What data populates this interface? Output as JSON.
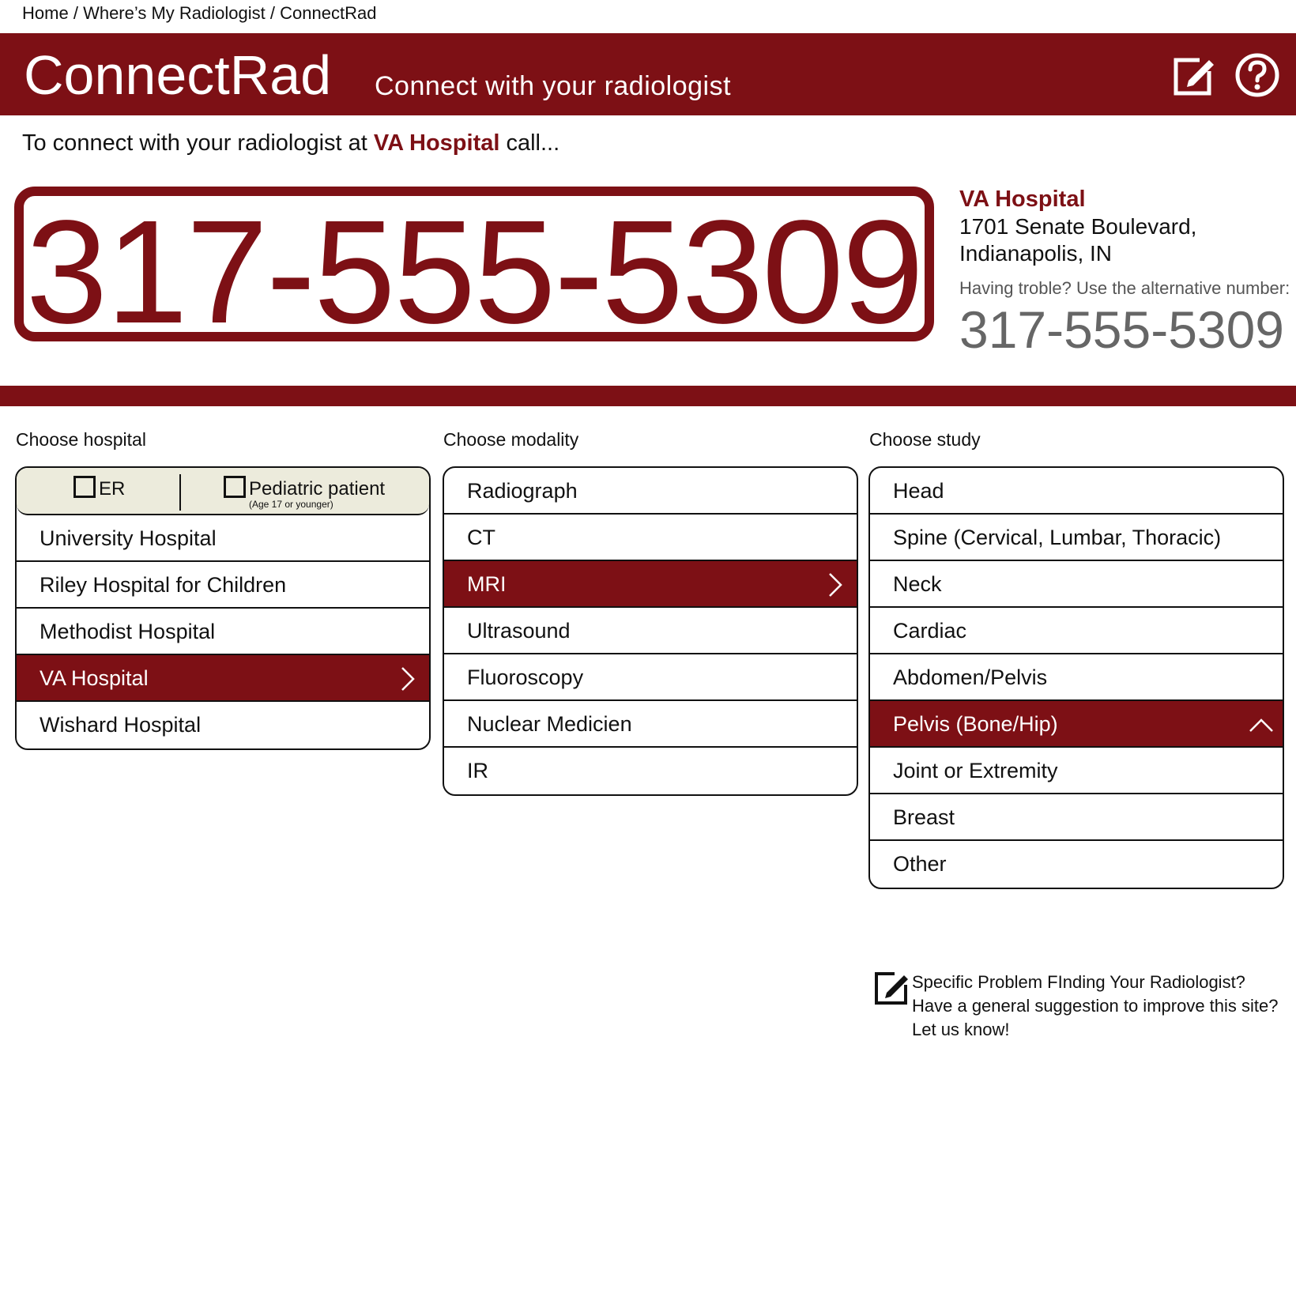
{
  "breadcrumb": {
    "home": "Home",
    "sep1": "/",
    "parent": "Where’s My Radiologist",
    "sep2": "/",
    "current": "ConnectRad"
  },
  "header": {
    "title": "ConnectRad",
    "tagline": "Connect with your radiologist",
    "edit_icon": "edit-icon",
    "help_icon": "help-icon"
  },
  "intro": {
    "prefix": "To connect with your radiologist at",
    "hospital": "VA Hospital",
    "suffix": "call..."
  },
  "primary_phone": "317-555-5309",
  "location": {
    "name": "VA Hospital",
    "address_line1": "1701 Senate Boulevard,",
    "address_line2": "Indianapolis, IN"
  },
  "alternative": {
    "label": "Having troble? Use the alternative number:",
    "phone": "317-555-5309"
  },
  "hospital_column": {
    "label": "Choose hospital",
    "filters": {
      "er": "ER",
      "pediatric": "Pediatric patient",
      "pediatric_note": "(Age 17 or younger)"
    },
    "items": [
      {
        "label": "University Hospital",
        "selected": false
      },
      {
        "label": "Riley Hospital for Children",
        "selected": false
      },
      {
        "label": "Methodist Hospital",
        "selected": false
      },
      {
        "label": "VA Hospital",
        "selected": true
      },
      {
        "label": "Wishard Hospital",
        "selected": false
      }
    ]
  },
  "modality_column": {
    "label": "Choose modality",
    "items": [
      {
        "label": "Radiograph",
        "selected": false
      },
      {
        "label": "CT",
        "selected": false
      },
      {
        "label": "MRI",
        "selected": true
      },
      {
        "label": "Ultrasound",
        "selected": false
      },
      {
        "label": "Fluoroscopy",
        "selected": false
      },
      {
        "label": "Nuclear Medicien",
        "selected": false
      },
      {
        "label": "IR",
        "selected": false
      }
    ]
  },
  "study_column": {
    "label": "Choose study",
    "items": [
      {
        "label": "Head",
        "selected": false
      },
      {
        "label": "Spine (Cervical, Lumbar, Thoracic)",
        "selected": false
      },
      {
        "label": "Neck",
        "selected": false
      },
      {
        "label": "Cardiac",
        "selected": false
      },
      {
        "label": "Abdomen/Pelvis",
        "selected": false
      },
      {
        "label": "Pelvis (Bone/Hip)",
        "selected": true
      },
      {
        "label": "Joint or Extremity",
        "selected": false
      },
      {
        "label": "Breast",
        "selected": false
      },
      {
        "label": "Other",
        "selected": false
      }
    ]
  },
  "feedback": {
    "text": "Specific Problem FInding Your Radiologist? Have a general suggestion to improve this site? Let us know!"
  },
  "colors": {
    "brand": "#7d1015",
    "filter_bg": "#ecebdc",
    "muted": "#666666"
  }
}
